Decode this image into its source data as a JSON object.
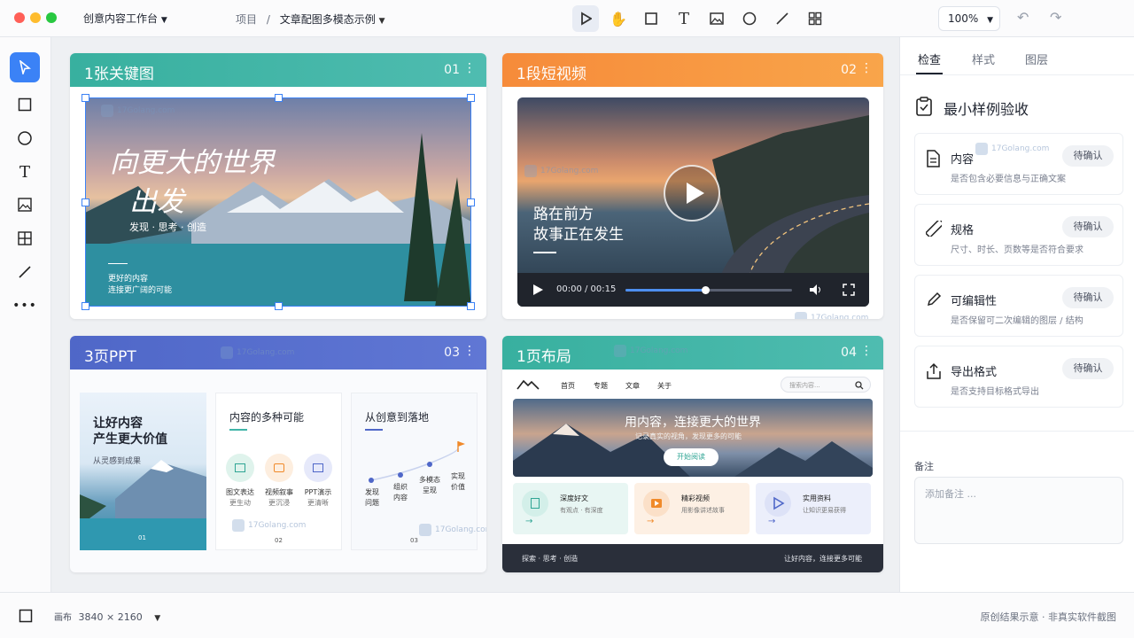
{
  "window": {
    "workspace": "创意内容工作台",
    "breadcrumb_root": "项目",
    "breadcrumb_sep": "/",
    "breadcrumb_current": "文章配图多模态示例",
    "zoom": "100%"
  },
  "colors": {
    "accent": "#3b82f6",
    "card1": "#3fb4a8",
    "card2": "#f79a3e",
    "card3": "#4f67c8",
    "card4": "#3fb4a8"
  },
  "cards": [
    {
      "title": "1张关键图",
      "num": "01",
      "headline1": "向更大的世界",
      "headline2": "出发",
      "tagline": "发现 · 思考 · 创造",
      "sub1": "更好的内容",
      "sub2": "连接更广阔的可能"
    },
    {
      "title": "1段短视频",
      "num": "02",
      "line1": "路在前方",
      "line2": "故事正在发生",
      "time": "00:00 / 00:15",
      "progress": 0.48
    },
    {
      "title": "3页PPT",
      "num": "03",
      "slide1": {
        "title1": "让好内容",
        "title2": "产生更大价值",
        "sub": "从灵感到成果",
        "page": "01"
      },
      "slide2": {
        "title": "内容的多种可能",
        "items": [
          {
            "l1": "图文表达",
            "l2": "更生动"
          },
          {
            "l1": "视频叙事",
            "l2": "更沉浸"
          },
          {
            "l1": "PPT演示",
            "l2": "更清晰"
          }
        ],
        "page": "02"
      },
      "slide3": {
        "title": "从创意到落地",
        "steps": [
          {
            "l1": "发现",
            "l2": "问题"
          },
          {
            "l1": "组织",
            "l2": "内容"
          },
          {
            "l1": "多模态",
            "l2": "呈现"
          },
          {
            "l1": "实现",
            "l2": "价值"
          }
        ],
        "page": "03"
      }
    },
    {
      "title": "1页布局",
      "num": "04",
      "nav": [
        "首页",
        "专题",
        "文章",
        "关于"
      ],
      "search_placeholder": "搜索内容...",
      "hero_title": "用内容，连接更大的世界",
      "hero_sub": "记录真实的视角，发现更多的可能",
      "hero_btn": "开始阅读",
      "features": [
        {
          "title": "深度好文",
          "desc": "有观点 · 有深度",
          "bg": "#e8f6f3",
          "fg": "#2fa594"
        },
        {
          "title": "精彩视频",
          "desc": "用影像讲述故事",
          "bg": "#fdf0e4",
          "fg": "#f08a2a"
        },
        {
          "title": "实用资料",
          "desc": "让知识更易获得",
          "bg": "#eceffb",
          "fg": "#4f67c8"
        }
      ],
      "footer_left": "探索 · 思考 · 创造",
      "footer_right": "让好内容，连接更多可能"
    }
  ],
  "watermark": "17Golang.com",
  "inspector": {
    "tabs": [
      "检查",
      "样式",
      "图层"
    ],
    "title": "最小样例验收",
    "items": [
      {
        "title": "内容",
        "desc": "是否包含必要信息与正确文案",
        "btn": "待确认",
        "icon": "document-icon"
      },
      {
        "title": "规格",
        "desc": "尺寸、时长、页数等是否符合要求",
        "btn": "待确认",
        "icon": "ruler-icon"
      },
      {
        "title": "可编辑性",
        "desc": "是否保留可二次编辑的图层 / 结构",
        "btn": "待确认",
        "icon": "pencil-icon"
      },
      {
        "title": "导出格式",
        "desc": "是否支持目标格式导出",
        "btn": "待确认",
        "icon": "upload-icon"
      }
    ],
    "notes_label": "备注",
    "notes_placeholder": "添加备注 ..."
  },
  "status": {
    "canvas_label": "画布",
    "canvas_size": "3840 × 2160",
    "note": "原创结果示意 · 非真实软件截图"
  }
}
